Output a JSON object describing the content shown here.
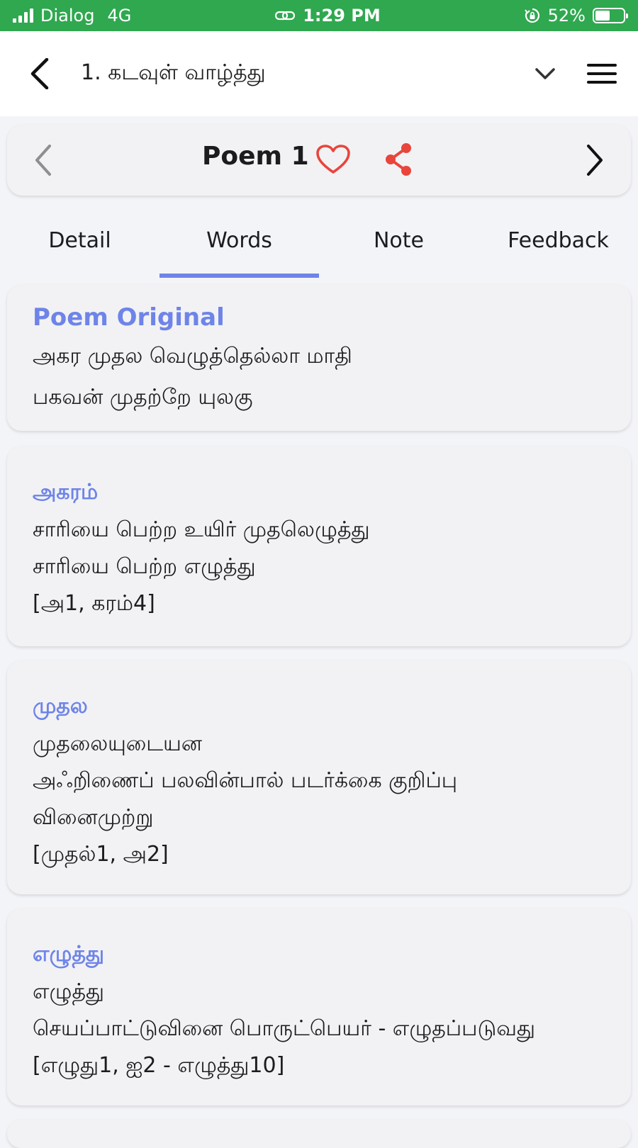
{
  "status_bar": {
    "carrier": "Dialog",
    "network": "4G",
    "time": "1:29 PM",
    "battery": "52%",
    "battery_level": 0.52
  },
  "header": {
    "title": "1. கடவுள் வாழ்த்து"
  },
  "poem_nav": {
    "title": "Poem 1"
  },
  "tabs": [
    {
      "label": "Detail"
    },
    {
      "label": "Words"
    },
    {
      "label": "Note"
    },
    {
      "label": "Feedback"
    }
  ],
  "colors": {
    "accent": "#6e84e8",
    "status_bar": "#2fa84f",
    "icon_red": "#e8453c"
  },
  "poem_original": {
    "title": "Poem Original",
    "lines": [
      "அகர முதல வெழுத்தெல்லா மாதி",
      "பகவன் முதற்றே யுலகு"
    ]
  },
  "words": [
    {
      "word": "அகரம்",
      "lines": [
        "சாரியை பெற்ற உயிர் முதலெழுத்து",
        "சாரியை பெற்ற எழுத்து",
        "[அ1, கரம்4]"
      ]
    },
    {
      "word": "முதல",
      "lines": [
        "முதலையுடையன",
        "அஃறிணைப் பலவின்பால் படர்க்கை குறிப்பு",
        "வினைமுற்று",
        "[முதல்1, அ2]"
      ]
    },
    {
      "word": "எழுத்து",
      "lines": [
        "எழுத்து",
        "செயப்பாட்டுவினை பொருட்பெயர் - எழுதப்படுவது",
        "[எழுது1, ஐ2 - எழுத்து10]"
      ]
    }
  ]
}
